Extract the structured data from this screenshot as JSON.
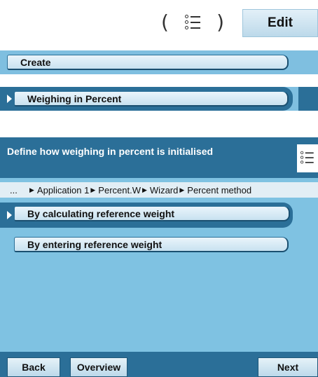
{
  "top": {
    "list_icon_open": "(",
    "list_icon_close": ")",
    "edit_label": "Edit"
  },
  "menu": {
    "create_label": "Create",
    "weighing_label": "Weighing in Percent"
  },
  "panel": {
    "title": "Define how weighing in percent is initialised",
    "breadcrumb": {
      "ellipsis": "...",
      "items": [
        "Application 1",
        "Percent.W",
        "Wizard",
        "Percent method"
      ],
      "separator": "▶"
    },
    "options": [
      {
        "label": "By calculating reference weight",
        "selected": true
      },
      {
        "label": "By entering reference weight",
        "selected": false
      }
    ]
  },
  "footer": {
    "back_label": "Back",
    "overview_label": "Overview",
    "next_label": "Next"
  },
  "colors": {
    "dark_blue": "#2b6f98",
    "light_blue": "#7fc2e2",
    "button_face": "#c8e2f0"
  }
}
